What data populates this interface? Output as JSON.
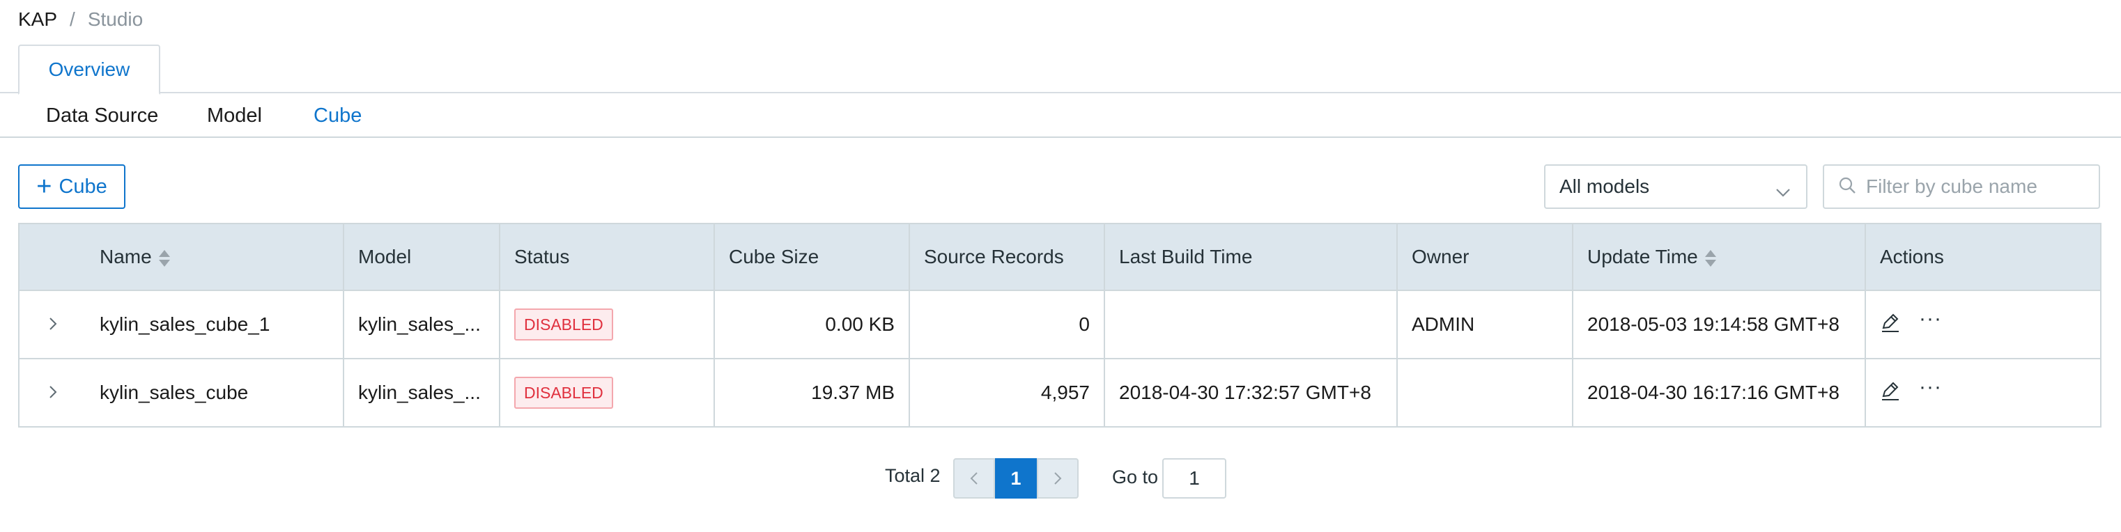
{
  "breadcrumb": {
    "root": "KAP",
    "separator": "/",
    "current": "Studio"
  },
  "tabs": {
    "overview": "Overview"
  },
  "subnav": [
    {
      "label": "Data Source",
      "active": false
    },
    {
      "label": "Model",
      "active": false
    },
    {
      "label": "Cube",
      "active": true
    }
  ],
  "toolbar": {
    "add_button": "Cube",
    "model_select": "All models",
    "search_placeholder": "Filter by cube name"
  },
  "table": {
    "headers": {
      "name": "Name",
      "model": "Model",
      "status": "Status",
      "cube_size": "Cube Size",
      "source_records": "Source Records",
      "last_build_time": "Last Build Time",
      "owner": "Owner",
      "update_time": "Update Time",
      "actions": "Actions"
    },
    "rows": [
      {
        "name": "kylin_sales_cube_1",
        "model": "kylin_sales_...",
        "status": "DISABLED",
        "cube_size": "0.00 KB",
        "source_records": "0",
        "last_build_time": "",
        "owner": "ADMIN",
        "update_time": "2018-05-03 19:14:58 GMT+8"
      },
      {
        "name": "kylin_sales_cube",
        "model": "kylin_sales_...",
        "status": "DISABLED",
        "cube_size": "19.37 MB",
        "source_records": "4,957",
        "last_build_time": "2018-04-30 17:32:57 GMT+8",
        "owner": "",
        "update_time": "2018-04-30 16:17:16 GMT+8"
      }
    ]
  },
  "pagination": {
    "total_label": "Total 2",
    "current_page": "1",
    "goto_label": "Go to",
    "goto_value": "1"
  },
  "colors": {
    "accent": "#0f75cc",
    "header_bg": "#dce6ed",
    "disabled_text": "#e0303e",
    "disabled_bg": "#fdecee"
  }
}
